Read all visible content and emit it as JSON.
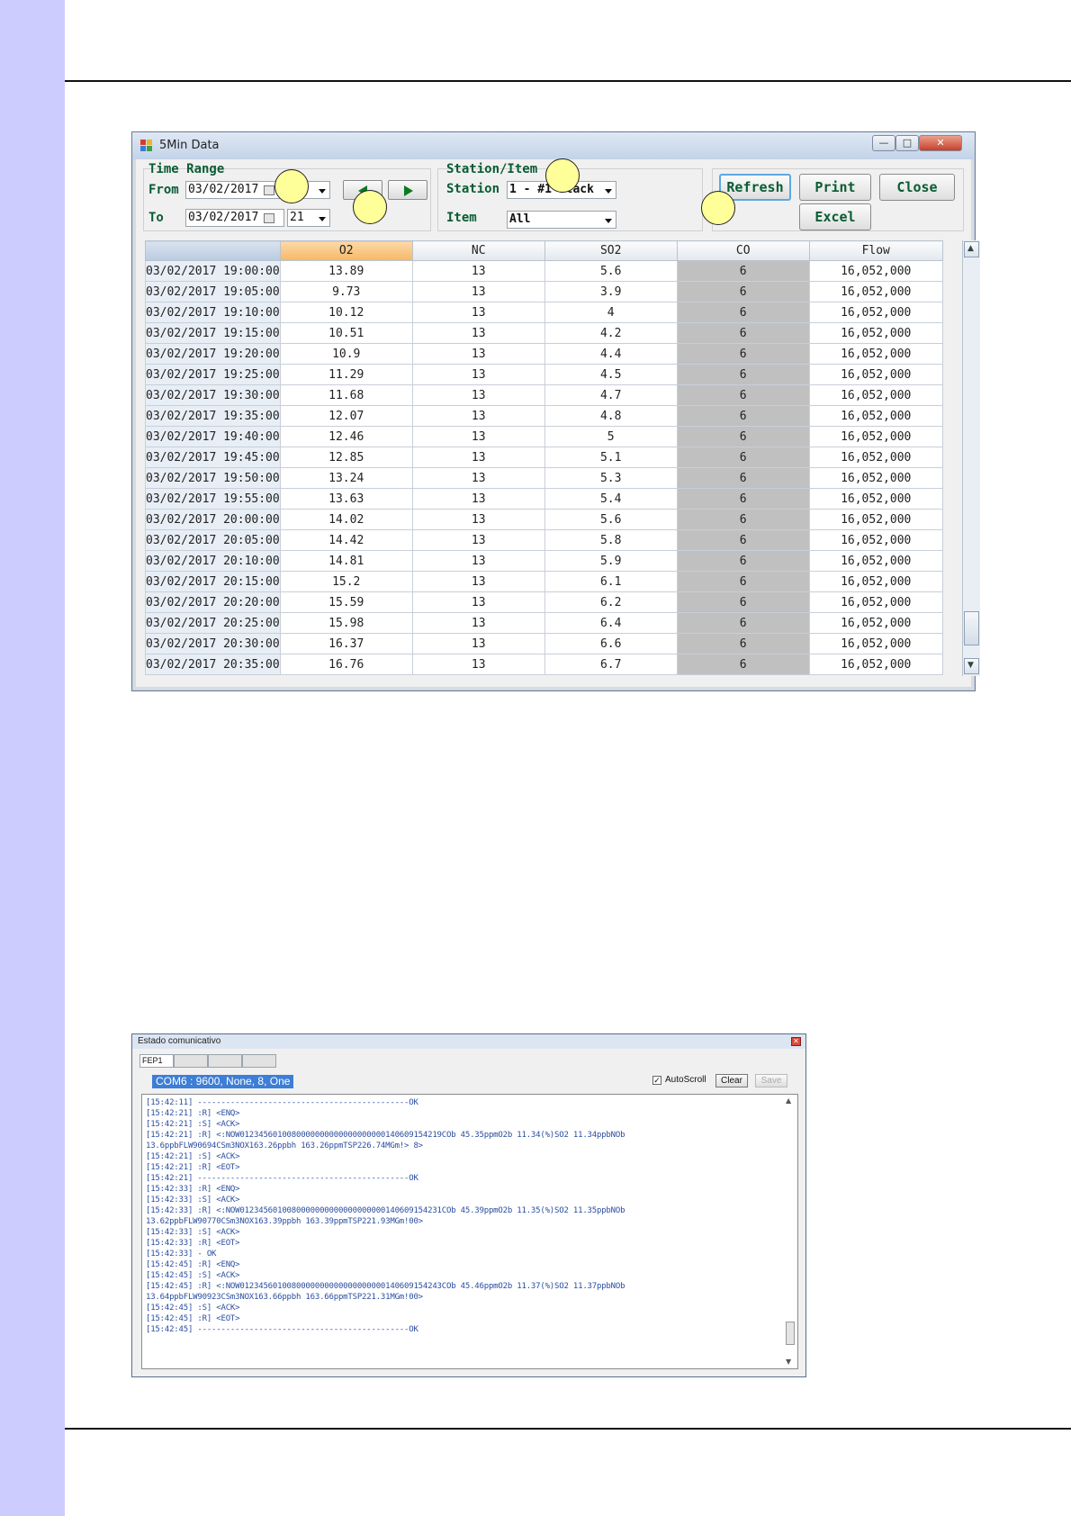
{
  "window1": {
    "title": "5Min Data",
    "time_range": {
      "title": "Time Range",
      "from_label": "From",
      "from_date": "03/02/2017",
      "to_label": "To",
      "to_date": "03/02/2017",
      "to_hour": "21"
    },
    "station_item": {
      "title": "Station/Item",
      "station_label": "Station",
      "station_value": "1 - #1 Stack",
      "item_label": "Item",
      "item_value": "All"
    },
    "buttons": {
      "refresh": "Refresh",
      "print": "Print",
      "close": "Close",
      "excel": "Excel"
    },
    "grid": {
      "columns": [
        "O2",
        "NC",
        "SO2",
        "CO",
        "Flow"
      ],
      "rows": [
        [
          "03/02/2017 19:00:00",
          "13.89",
          "13",
          "5.6",
          "6",
          "16,052,000"
        ],
        [
          "03/02/2017 19:05:00",
          "9.73",
          "13",
          "3.9",
          "6",
          "16,052,000"
        ],
        [
          "03/02/2017 19:10:00",
          "10.12",
          "13",
          "4",
          "6",
          "16,052,000"
        ],
        [
          "03/02/2017 19:15:00",
          "10.51",
          "13",
          "4.2",
          "6",
          "16,052,000"
        ],
        [
          "03/02/2017 19:20:00",
          "10.9",
          "13",
          "4.4",
          "6",
          "16,052,000"
        ],
        [
          "03/02/2017 19:25:00",
          "11.29",
          "13",
          "4.5",
          "6",
          "16,052,000"
        ],
        [
          "03/02/2017 19:30:00",
          "11.68",
          "13",
          "4.7",
          "6",
          "16,052,000"
        ],
        [
          "03/02/2017 19:35:00",
          "12.07",
          "13",
          "4.8",
          "6",
          "16,052,000"
        ],
        [
          "03/02/2017 19:40:00",
          "12.46",
          "13",
          "5",
          "6",
          "16,052,000"
        ],
        [
          "03/02/2017 19:45:00",
          "12.85",
          "13",
          "5.1",
          "6",
          "16,052,000"
        ],
        [
          "03/02/2017 19:50:00",
          "13.24",
          "13",
          "5.3",
          "6",
          "16,052,000"
        ],
        [
          "03/02/2017 19:55:00",
          "13.63",
          "13",
          "5.4",
          "6",
          "16,052,000"
        ],
        [
          "03/02/2017 20:00:00",
          "14.02",
          "13",
          "5.6",
          "6",
          "16,052,000"
        ],
        [
          "03/02/2017 20:05:00",
          "14.42",
          "13",
          "5.8",
          "6",
          "16,052,000"
        ],
        [
          "03/02/2017 20:10:00",
          "14.81",
          "13",
          "5.9",
          "6",
          "16,052,000"
        ],
        [
          "03/02/2017 20:15:00",
          "15.2",
          "13",
          "6.1",
          "6",
          "16,052,000"
        ],
        [
          "03/02/2017 20:20:00",
          "15.59",
          "13",
          "6.2",
          "6",
          "16,052,000"
        ],
        [
          "03/02/2017 20:25:00",
          "15.98",
          "13",
          "6.4",
          "6",
          "16,052,000"
        ],
        [
          "03/02/2017 20:30:00",
          "16.37",
          "13",
          "6.6",
          "6",
          "16,052,000"
        ],
        [
          "03/02/2017 20:35:00",
          "16.76",
          "13",
          "6.7",
          "6",
          "16,052,000"
        ]
      ]
    }
  },
  "window2": {
    "title": "Estado comunicativo",
    "tabs": [
      "FEP1",
      "",
      "",
      ""
    ],
    "com_label": "COM6 : 9600, None, 8, One",
    "autoscroll_label": "AutoScroll",
    "autoscroll_checked": "✓",
    "clear_label": "Clear",
    "save_label": "Save",
    "log_lines": [
      "[15:42:11] ---------------------------------------------OK",
      "[15:42:21] :R] <ENQ>",
      "[15:42:21] :S] <ACK>",
      "[15:42:21] :R] <:NOW0123456010080000000000000000000140609154219COb 45.35ppmO2b 11.34(%)SO2 11.34ppbNOb",
      "13.6ppbFLW90694CSm3NOX163.26ppbh 163.26ppmTSP226.74MGm!> 8>",
      "[15:42:21] :S] <ACK>",
      "[15:42:21] :R] <EOT>",
      "[15:42:21] ---------------------------------------------OK",
      "[15:42:33] :R] <ENQ>",
      "[15:42:33] :S] <ACK>",
      "[15:42:33] :R] <:NOW0123456010080000000000000000000140609154231COb 45.39ppmO2b 11.35(%)SO2 11.35ppbNOb",
      "13.62ppbFLW90770CSm3NOX163.39ppbh 163.39ppmTSP221.93MGm!00>",
      "[15:42:33] :S] <ACK>",
      "[15:42:33] :R] <EOT>",
      "[15:42:33] -                                            OK",
      "[15:42:45] :R] <ENQ>",
      "[15:42:45] :S] <ACK>",
      "[15:42:45] :R] <:NOW0123456010080000000000000000000140609154243COb 45.46ppmO2b 11.37(%)SO2 11.37ppbNOb",
      "13.64ppbFLW90923CSm3NOX163.66ppbh 163.66ppmTSP221.31MGm!00>",
      "[15:42:45] :S] <ACK>",
      "[15:42:45] :R] <EOT>",
      "[15:42:45] ---------------------------------------------OK"
    ]
  },
  "colors": {
    "side_band": "#ccccff",
    "label_green": "#0a5c33",
    "selected_header": "#f6b767",
    "co_column": "#c0c0c0",
    "callout": "#ffff99",
    "log_text": "#2b4ea0",
    "com_highlight": "#3d7ed6"
  }
}
